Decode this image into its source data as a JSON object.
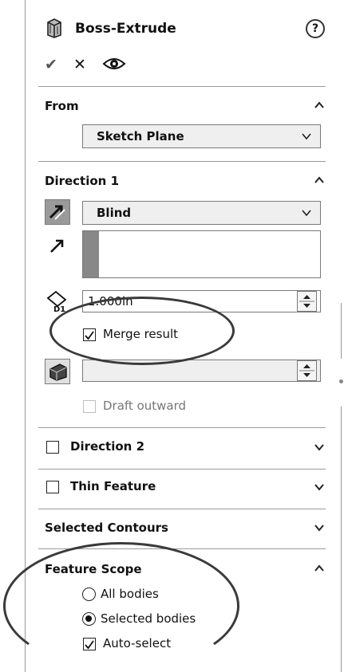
{
  "header": {
    "title": "Boss-Extrude",
    "help_glyph": "?",
    "ok_glyph": "✔",
    "cancel_glyph": "✕",
    "preview_glyph": "👁"
  },
  "from": {
    "title": "From",
    "start_condition": "Sketch Plane"
  },
  "direction1": {
    "title": "Direction 1",
    "end_condition": "Blind",
    "depth_value": "1.000in",
    "merge_result_label": "Merge result",
    "merge_result_checked": true,
    "draft_value": "",
    "draft_outward_label": "Draft outward"
  },
  "direction2": {
    "title": "Direction 2"
  },
  "thin_feature": {
    "title": "Thin Feature"
  },
  "selected_contours": {
    "title": "Selected Contours"
  },
  "feature_scope": {
    "title": "Feature Scope",
    "all_bodies_label": "All bodies",
    "selected_bodies_label": "Selected bodies",
    "selected_option": "Selected bodies",
    "auto_select_label": "Auto-select",
    "auto_select_checked": true
  },
  "colors": {
    "separator": "#9a9a9a",
    "annotation": "#3a3a3a",
    "accent_bar": "#888888"
  }
}
